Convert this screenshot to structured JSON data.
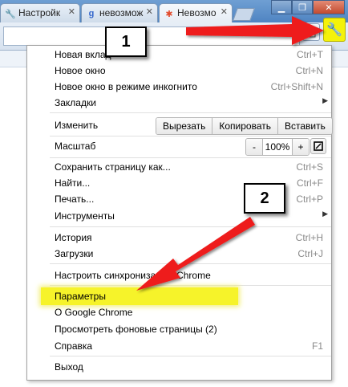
{
  "tabs": [
    {
      "title": "Настройк",
      "icon": "wrench-icon"
    },
    {
      "title": "невозмож",
      "icon": "google-icon"
    },
    {
      "title": "Невозмо",
      "icon": "joomla-icon"
    }
  ],
  "menu": {
    "items": [
      {
        "label": "Новая вклад",
        "shortcut": "Ctrl+T"
      },
      {
        "label": "Новое окно",
        "shortcut": "Ctrl+N"
      },
      {
        "label": "Новое окно в режиме инкогнито",
        "shortcut": "Ctrl+Shift+N"
      },
      {
        "label": "Закладки",
        "shortcut": ""
      },
      {
        "label": "Изменить",
        "shortcut": ""
      },
      {
        "label": "Масштаб",
        "shortcut": ""
      },
      {
        "label": "Сохранить страницу как...",
        "shortcut": "Ctrl+S"
      },
      {
        "label": "Найти...",
        "shortcut": "Ctrl+F"
      },
      {
        "label": "Печать...",
        "shortcut": "Ctrl+P"
      },
      {
        "label": "Инструменты",
        "shortcut": ""
      },
      {
        "label": "История",
        "shortcut": "Ctrl+H"
      },
      {
        "label": "Загрузки",
        "shortcut": "Ctrl+J"
      },
      {
        "label": "Настроить синхронизацию Chrome",
        "shortcut": ""
      },
      {
        "label": "Параметры",
        "shortcut": ""
      },
      {
        "label": "О Google Chrome",
        "shortcut": ""
      },
      {
        "label": "Просмотреть фоновые страницы (2)",
        "shortcut": ""
      },
      {
        "label": "Справка",
        "shortcut": "F1"
      },
      {
        "label": "Выход",
        "shortcut": ""
      }
    ],
    "edit": {
      "cut": "Вырезать",
      "copy": "Копировать",
      "paste": "Вставить"
    },
    "zoom": {
      "minus": "-",
      "level": "100%",
      "plus": "+"
    }
  },
  "annotations": {
    "callout1": "1",
    "callout2": "2"
  },
  "colors": {
    "highlight": "#f6f32a",
    "arrow": "#ee1c1c",
    "wrench_bg": "#f4f20a"
  }
}
